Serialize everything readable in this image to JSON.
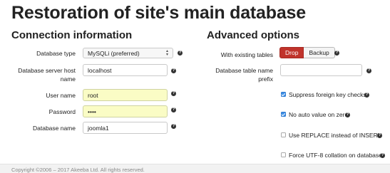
{
  "page_title": "Restoration of site's main database",
  "connection": {
    "heading": "Connection information",
    "db_type": {
      "label": "Database type",
      "value": "MySQLi (preferred)"
    },
    "host": {
      "label_line1": "Database server host",
      "label_line2": "name",
      "value": "localhost"
    },
    "user": {
      "label": "User name",
      "value": "root"
    },
    "password": {
      "label": "Password",
      "value": "••••"
    },
    "db_name": {
      "label": "Database name",
      "value": "joomla1"
    }
  },
  "advanced": {
    "heading": "Advanced options",
    "existing_tables": {
      "label": "With existing tables",
      "options": [
        "Drop",
        "Backup"
      ],
      "selected": "Drop"
    },
    "prefix": {
      "label_line1": "Database table name",
      "label_line2": "prefix",
      "value": ""
    },
    "checkboxes": [
      {
        "label": "Suppress foreign key checks",
        "checked": true
      },
      {
        "label": "No auto value on zero",
        "checked": true
      },
      {
        "label": "Use REPLACE instead of INSERT",
        "checked": false
      },
      {
        "label": "Force UTF-8 collation on database",
        "checked": false
      }
    ]
  },
  "footer": {
    "text": "Copyright ©2006 – 2017 Akeeba Ltd. All rights reserved."
  },
  "colors": {
    "accent": "#c0332b",
    "checkbox": "#3d8fe6",
    "autofill": "#fafcc5"
  },
  "help_icon_glyph": "?"
}
